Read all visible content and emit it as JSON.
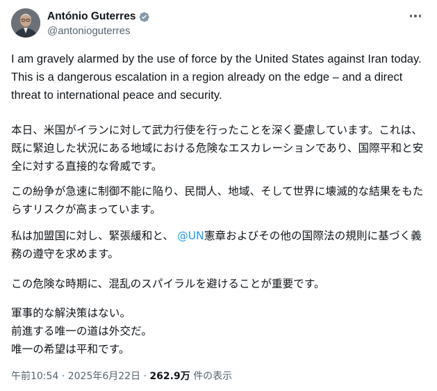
{
  "author": {
    "display_name": "António Guterres",
    "handle": "@antonioguterres"
  },
  "tweet": {
    "english_text": "I am gravely alarmed by the use of force by the United States against Iran today. This is a dangerous escalation in a region already on the edge – and a direct threat to international peace and security.",
    "jp_paragraph_1": "本日、米国がイランに対して武力行使を行ったことを深く憂慮しています。これは、既に緊迫した状況にある地域における危険なエスカレーションであり、国際平和と安全に対する直接的な脅威です。",
    "jp_paragraph_2": "この紛争が急速に制御不能に陥り、民間人、地域、そして世界に壊滅的な結果をもたらすリスクが高まっています。",
    "jp_paragraph_3_before": "私は加盟国に対し、緊張緩和と、",
    "jp_paragraph_3_mention": "@UN",
    "jp_paragraph_3_after": "憲章およびその他の国際法の規則に基づく義務の遵守を求めます。",
    "jp_paragraph_4": "この危険な時期に、混乱のスパイラルを避けることが重要です。",
    "jp_paragraph_5_lines": [
      "軍事的な解決策はない。",
      "前進する唯一の道は外交だ。",
      "唯一の希望は平和です。"
    ]
  },
  "meta": {
    "time": "午前10:54",
    "separator": "·",
    "date": "2025年6月22日",
    "views_count": "262.9万",
    "views_label": "件の表示"
  },
  "colors": {
    "text": "#0f1419",
    "secondary": "#536471",
    "link": "#1d9bf0",
    "verified_badge": "#829aab"
  },
  "icons": [
    "verified-badge-icon",
    "more-options-icon"
  ]
}
